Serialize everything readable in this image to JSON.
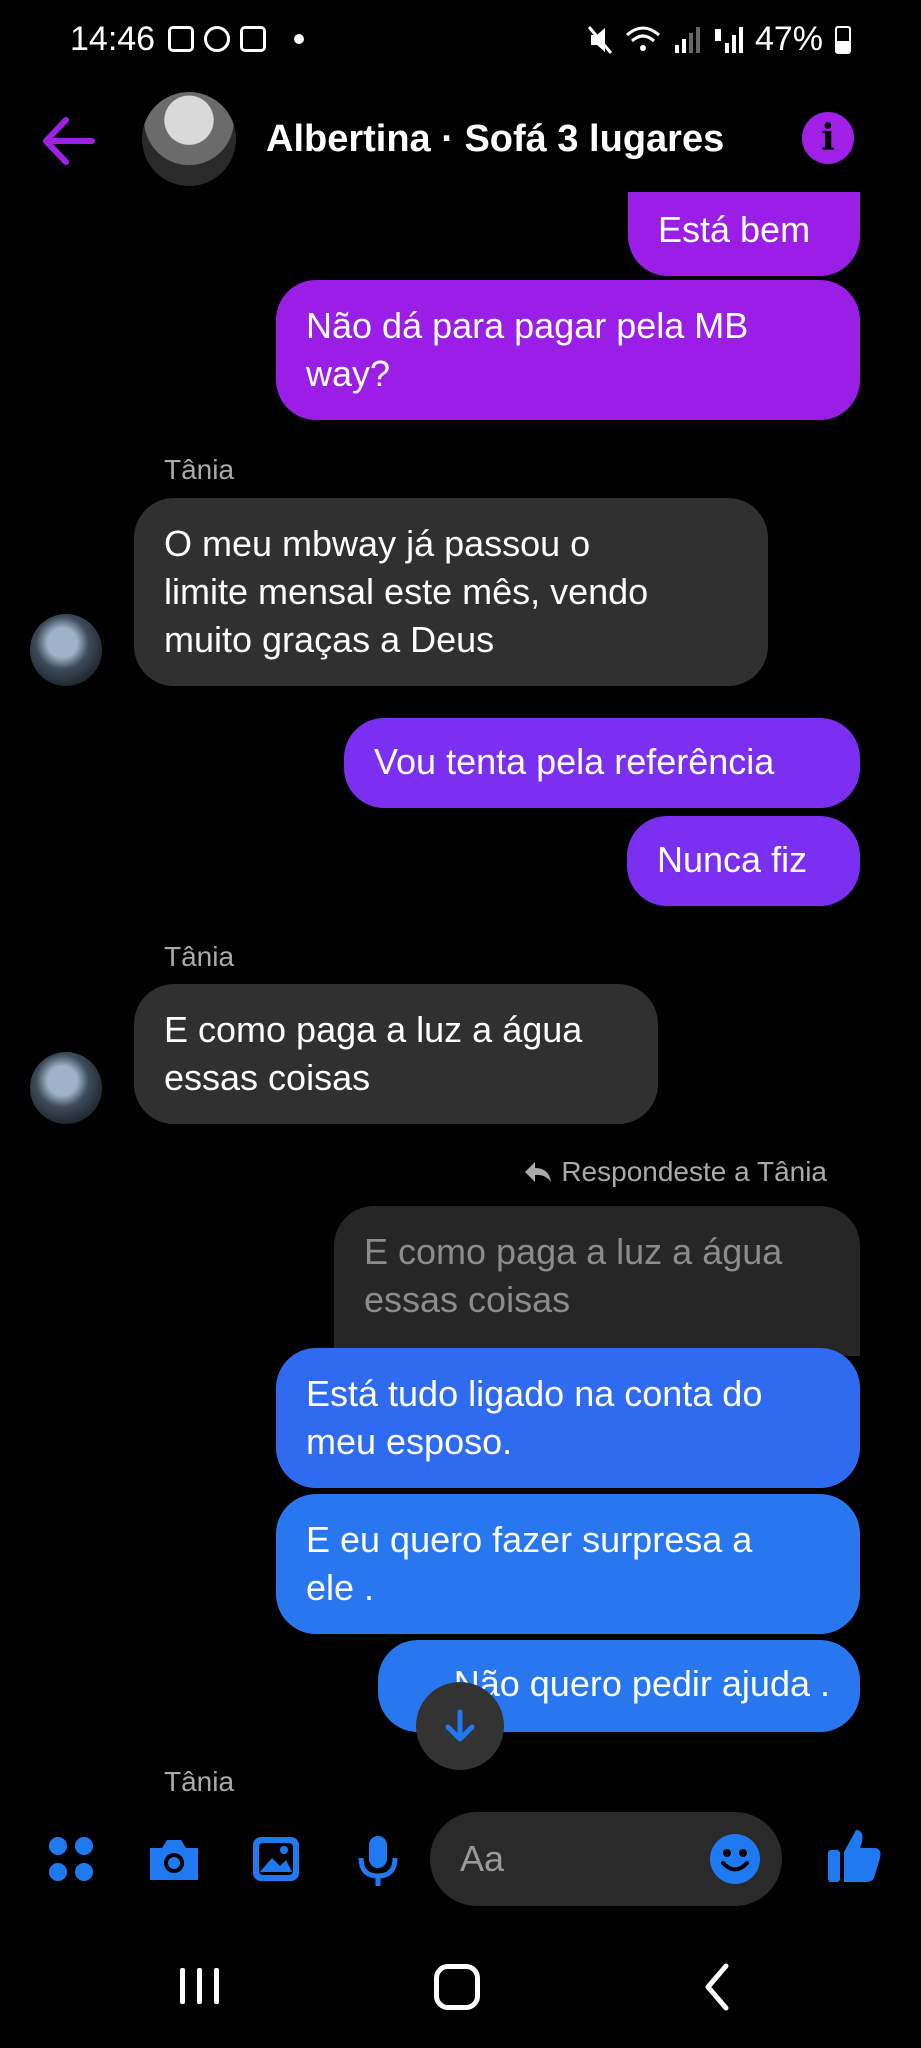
{
  "status_bar": {
    "time": "14:46",
    "battery": "47%"
  },
  "header": {
    "title": "Albertina · Sofá 3 lugares"
  },
  "messages": {
    "m1": "Está bem",
    "m2": "Não dá para pagar pela MB\nway?",
    "sender1": "Tânia",
    "m3": "O meu mbway já passou o\nlimite mensal este mês, vendo\nmuito graças a Deus",
    "m4": "Vou tenta pela referência",
    "m5": "Nunca fiz",
    "sender2": "Tânia",
    "m6": "E como paga a luz a água\nessas coisas",
    "reply_label": "Respondeste a Tânia",
    "quote": "E como paga a luz a água\nessas coisas",
    "m7": "Está tudo ligado na conta do\nmeu esposo.",
    "m8": "E eu quero fazer surpresa a\nele .",
    "m9": "Não quero pedir ajuda .",
    "sender3": "Tânia"
  },
  "composer": {
    "placeholder": "Aa"
  },
  "colors": {
    "accent_purple": "#a020e8",
    "accent_blue": "#1f7af2"
  }
}
